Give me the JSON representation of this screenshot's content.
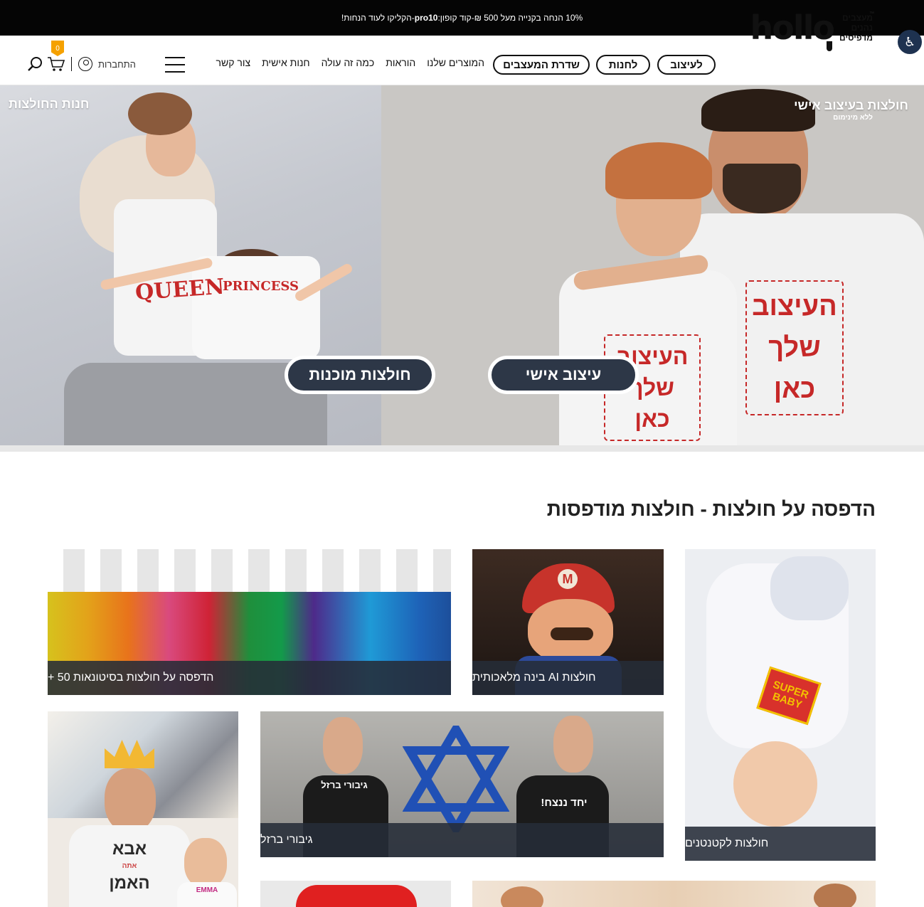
{
  "promo": {
    "text_before": "10% הנחה בקנייה מעל 500 ₪-קוד קופון:",
    "code": "pro10",
    "text_after": " -הקליקו לעוד הנחות!"
  },
  "header": {
    "accessibility_label": "♿",
    "logo": {
      "word": "hollo",
      "tag1": "מעצבים",
      "tag2": "נהנים",
      "tag3": "מדפיסים",
      "tm": "™"
    },
    "pills": [
      "לעיצוב",
      "לחנות",
      "שדרת המעצבים"
    ],
    "nav": [
      "המוצרים שלנו",
      "הוראות",
      "כמה זה עולה",
      "חנות אישית",
      "צור קשר"
    ],
    "login_label": "התחברות",
    "cart_count": "0"
  },
  "hero": {
    "left_tag": "חנות החולצות",
    "right_tag": "חולצות בעיצוב אישי",
    "right_sub": "ללא מינימום",
    "left_button": "חולצות מוכנות",
    "right_button": "עיצוב אישי",
    "shirt_queen": "QUEEN",
    "shirt_princess": "PRINCESS",
    "woman_shirt": [
      "העיצוב",
      "שלך",
      "כאן"
    ],
    "man_shirt": [
      "העיצוב",
      "שלך",
      "כאן"
    ]
  },
  "section": {
    "title": "הדפסה על חולצות - חולצות מודפסות",
    "tiles": [
      {
        "caption": "חולצות לקטנטנים"
      },
      {
        "caption": "חולצות AI בינה מלאכותית"
      },
      {
        "caption": "הדפסה על חולצות בסיטונאות 50 +"
      },
      {
        "caption": "גיבורי ברזל"
      },
      {
        "caption": ""
      },
      {
        "caption": ""
      },
      {
        "caption": ""
      }
    ],
    "baby_print": [
      "SUPER",
      "BABY"
    ],
    "dad_print": [
      "אבא",
      "אתה",
      "האמן"
    ],
    "emma_print": "EMMA",
    "mario_letter": "M",
    "hero_shirt_right": "יחד ננצח!",
    "hero_shirt_left": "גיבורי ברזל"
  }
}
